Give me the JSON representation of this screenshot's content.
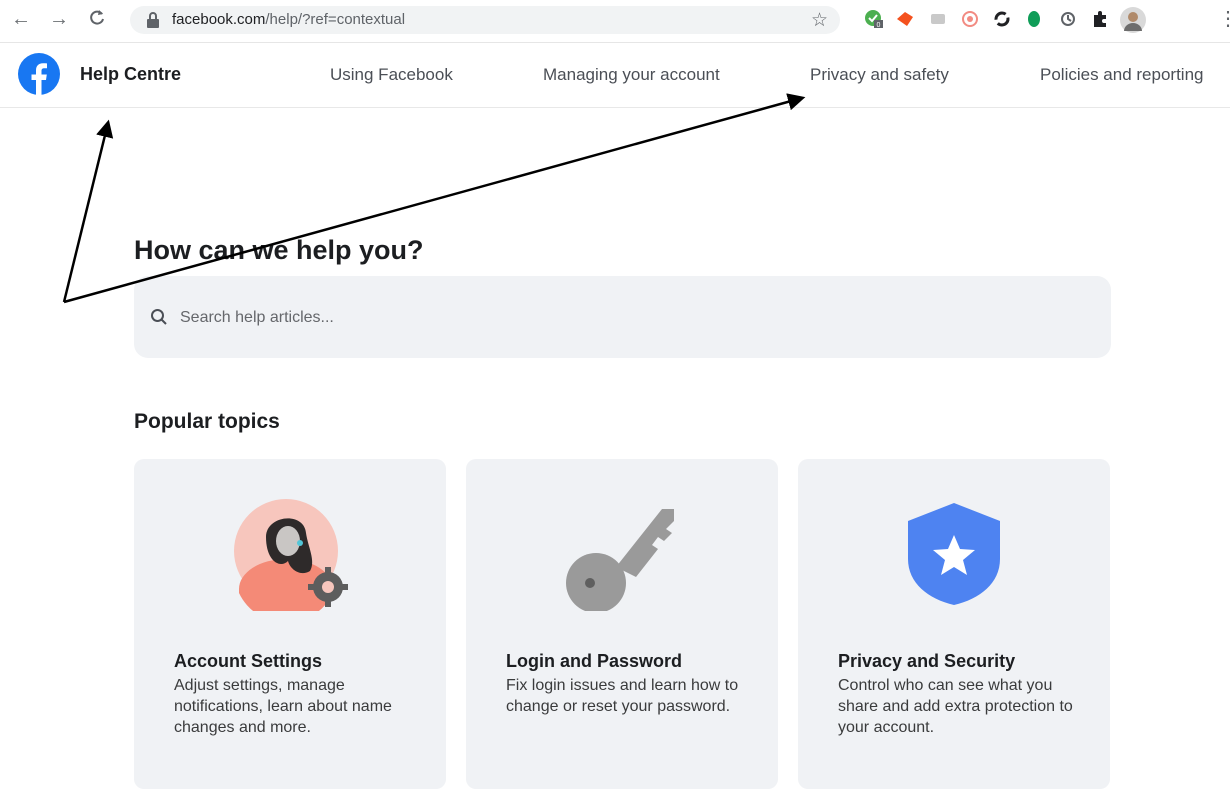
{
  "browser": {
    "url_domain": "facebook.com",
    "url_path": "/help/?ref=contextual",
    "extension_badge": "0",
    "icons": [
      "back-icon",
      "forward-icon",
      "reload-icon",
      "lock-icon",
      "bookmark-star-icon",
      "extension-icons",
      "puzzle-icon",
      "profile-avatar",
      "menu-kebab-icon"
    ]
  },
  "header": {
    "title": "Help Centre",
    "nav": [
      "Using Facebook",
      "Managing your account",
      "Privacy and safety",
      "Policies and reporting"
    ]
  },
  "main": {
    "headline": "How can we help you?",
    "search_placeholder": "Search help articles...",
    "popular_title": "Popular topics",
    "cards": [
      {
        "title": "Account Settings",
        "desc": "Adjust settings, manage notifications, learn about name changes and more.",
        "icon": "account-settings-icon"
      },
      {
        "title": "Login and Password",
        "desc": "Fix login issues and learn how to change or reset your password.",
        "icon": "key-icon"
      },
      {
        "title": "Privacy and Security",
        "desc": "Control who can see what you share and add extra protection to your account.",
        "icon": "shield-star-icon"
      }
    ]
  },
  "colors": {
    "brand": "#1877f2",
    "card_bg": "#f0f2f5",
    "shield": "#4e83f1",
    "key": "#9a9a9a"
  }
}
